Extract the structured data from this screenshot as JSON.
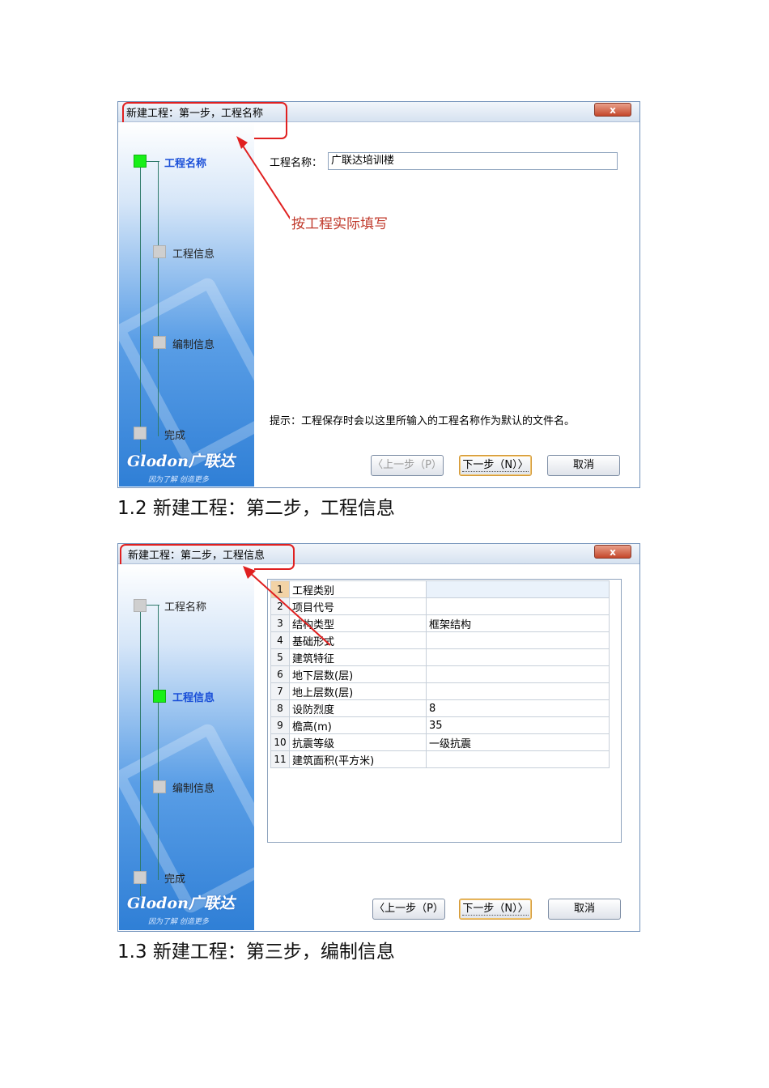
{
  "dialog1": {
    "title": "新建工程：第一步，工程名称",
    "close": "x",
    "steps": [
      "工程名称",
      "工程信息",
      "编制信息",
      "完成"
    ],
    "logo": "Glodon广联达",
    "slogan": "因为了解 创造更多",
    "field_label": "工程名称：",
    "field_value": "广联达培训楼",
    "annotation": "按工程实际填写",
    "hint": "提示：工程保存时会以这里所输入的工程名称作为默认的文件名。",
    "buttons": {
      "prev": "〈上一步（P）",
      "next": "下一步（N）〉",
      "cancel": "取消"
    }
  },
  "caption1": "1.2 新建工程：第二步，工程信息",
  "dialog2": {
    "title": "新建工程：第二步，工程信息",
    "close": "x",
    "steps": [
      "工程名称",
      "工程信息",
      "编制信息",
      "完成"
    ],
    "logo": "Glodon广联达",
    "slogan": "因为了解 创造更多",
    "rows": [
      {
        "no": "1",
        "name": "工程类别",
        "value": ""
      },
      {
        "no": "2",
        "name": "项目代号",
        "value": ""
      },
      {
        "no": "3",
        "name": "结构类型",
        "value": "框架结构"
      },
      {
        "no": "4",
        "name": "基础形式",
        "value": ""
      },
      {
        "no": "5",
        "name": "建筑特征",
        "value": ""
      },
      {
        "no": "6",
        "name": "地下层数(层)",
        "value": ""
      },
      {
        "no": "7",
        "name": "地上层数(层)",
        "value": ""
      },
      {
        "no": "8",
        "name": "设防烈度",
        "value": "8"
      },
      {
        "no": "9",
        "name": "檐高(m)",
        "value": "35"
      },
      {
        "no": "10",
        "name": "抗震等级",
        "value": "一级抗震"
      },
      {
        "no": "11",
        "name": "建筑面积(平方米)",
        "value": ""
      }
    ],
    "buttons": {
      "prev": "〈上一步（P）",
      "next": "下一步（N）〉",
      "cancel": "取消"
    }
  },
  "caption2": "1.3 新建工程：第三步，编制信息",
  "colors": {
    "annotation": "#e02020",
    "active_step": "#18f018",
    "sidebar": "#3f8ce0"
  }
}
